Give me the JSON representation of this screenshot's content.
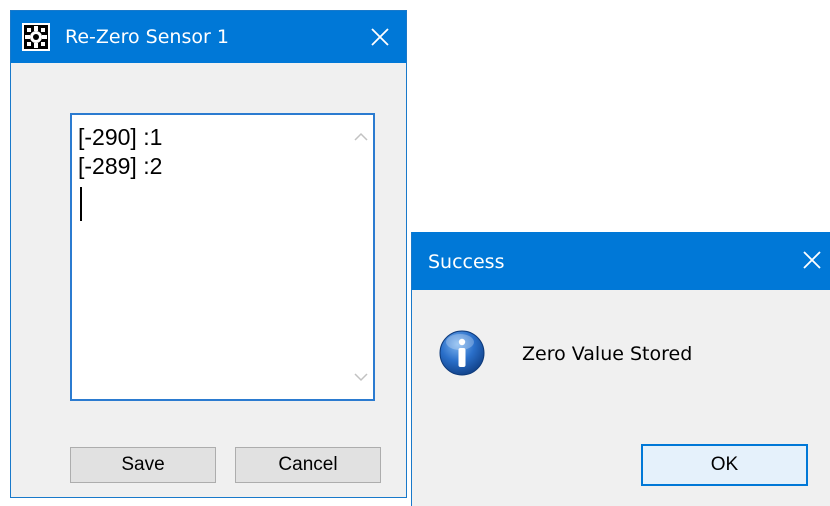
{
  "main_dialog": {
    "title": "Re-Zero Sensor 1",
    "app_icon": "gear-icon",
    "close_icon": "close-icon",
    "textbox": {
      "lines": [
        "[-290] :1",
        "[-289] :2"
      ],
      "scroll_up_icon": "chevron-up-icon",
      "scroll_down_icon": "chevron-down-icon"
    },
    "save_label": "Save",
    "cancel_label": "Cancel"
  },
  "success_dialog": {
    "title": "Success",
    "close_icon": "close-icon",
    "icon": "info-icon",
    "message": "Zero Value Stored",
    "ok_label": "OK"
  },
  "colors": {
    "titlebar": "#0078d7",
    "dialog_bg": "#f0f0f0",
    "button_bg": "#e1e1e1",
    "focus_border": "#0078d7"
  }
}
